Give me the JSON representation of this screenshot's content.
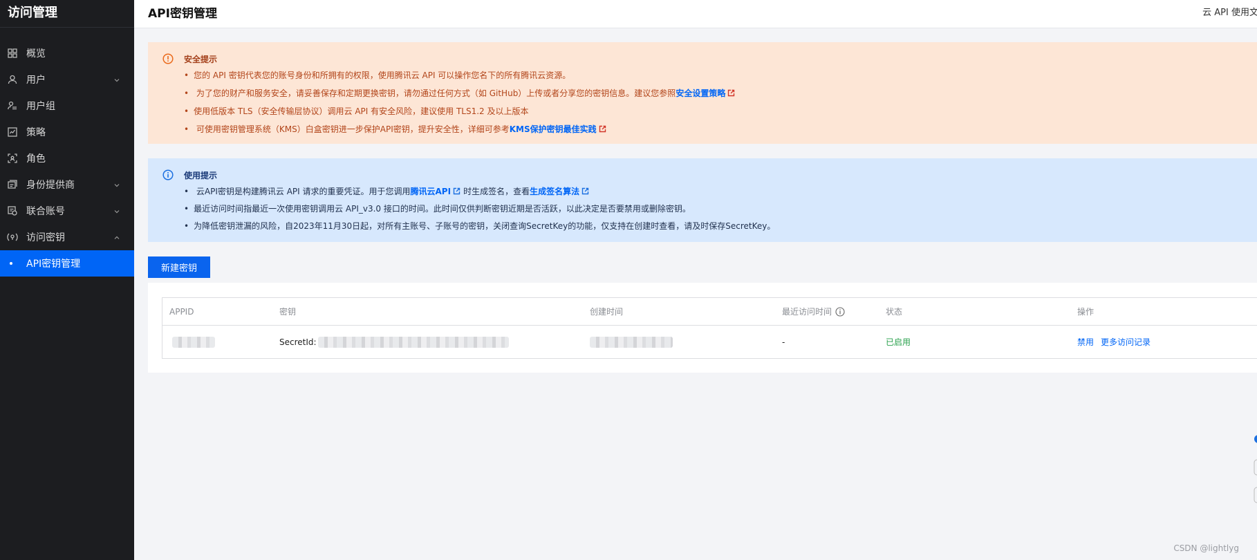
{
  "sidebar": {
    "title": "访问管理",
    "items": [
      {
        "label": "概览"
      },
      {
        "label": "用户"
      },
      {
        "label": "用户组"
      },
      {
        "label": "策略"
      },
      {
        "label": "角色"
      },
      {
        "label": "身份提供商"
      },
      {
        "label": "联合账号"
      },
      {
        "label": "访问密钥"
      },
      {
        "label": "API密钥管理"
      }
    ]
  },
  "header": {
    "title": "API密钥管理",
    "doc_link": "云 API 使用文"
  },
  "security_notice": {
    "title": "安全提示",
    "line1": "您的 API 密钥代表您的账号身份和所拥有的权限，使用腾讯云 API 可以操作您名下的所有腾讯云资源。",
    "line2_prefix": "为了您的财产和服务安全，请妥善保存和定期更换密钥，请勿通过任何方式（如 GitHub）上传或者分享您的密钥信息。建议您参照",
    "line2_link": "安全设置策略",
    "line3": "使用低版本 TLS（安全传输层协议）调用云 API 有安全风险，建议使用 TLS1.2 及以上版本",
    "line4_prefix": "可使用密钥管理系统（KMS）白盒密钥进一步保护API密钥，提升安全性，详细可参考",
    "line4_link": "KMS保护密钥最佳实践"
  },
  "usage_notice": {
    "title": "使用提示",
    "line1_prefix": "云API密钥是构建腾讯云 API 请求的重要凭证。用于您调用",
    "line1_link1": "腾讯云API",
    "line1_mid": "时生成签名，查看",
    "line1_link2": "生成签名算法",
    "line2": "最近访问时间指最近一次使用密钥调用云 API_v3.0 接口的时间。此时间仅供判断密钥近期是否活跃，以此决定是否要禁用或删除密钥。",
    "line3": "为降低密钥泄漏的风险，自2023年11月30日起，对所有主账号、子账号的密钥，关闭查询SecretKey的功能，仅支持在创建时查看，请及时保存SecretKey。"
  },
  "create_button": "新建密钥",
  "table": {
    "columns": [
      "APPID",
      "密钥",
      "创建时间",
      "最近访问时间",
      "状态",
      "操作"
    ],
    "rows": [
      {
        "secret_label": "SecretId:",
        "last_access": "-",
        "status": "已启用",
        "op_disable": "禁用",
        "op_more": "更多访问记录"
      }
    ]
  },
  "watermark": "CSDN @lightlyg",
  "colors": {
    "sidebar_bg": "#1c1d20",
    "accent": "#0065f6",
    "warn_bg": "#fde6d6",
    "info_bg": "#d7e8fd",
    "status_green": "#2aa14d"
  }
}
